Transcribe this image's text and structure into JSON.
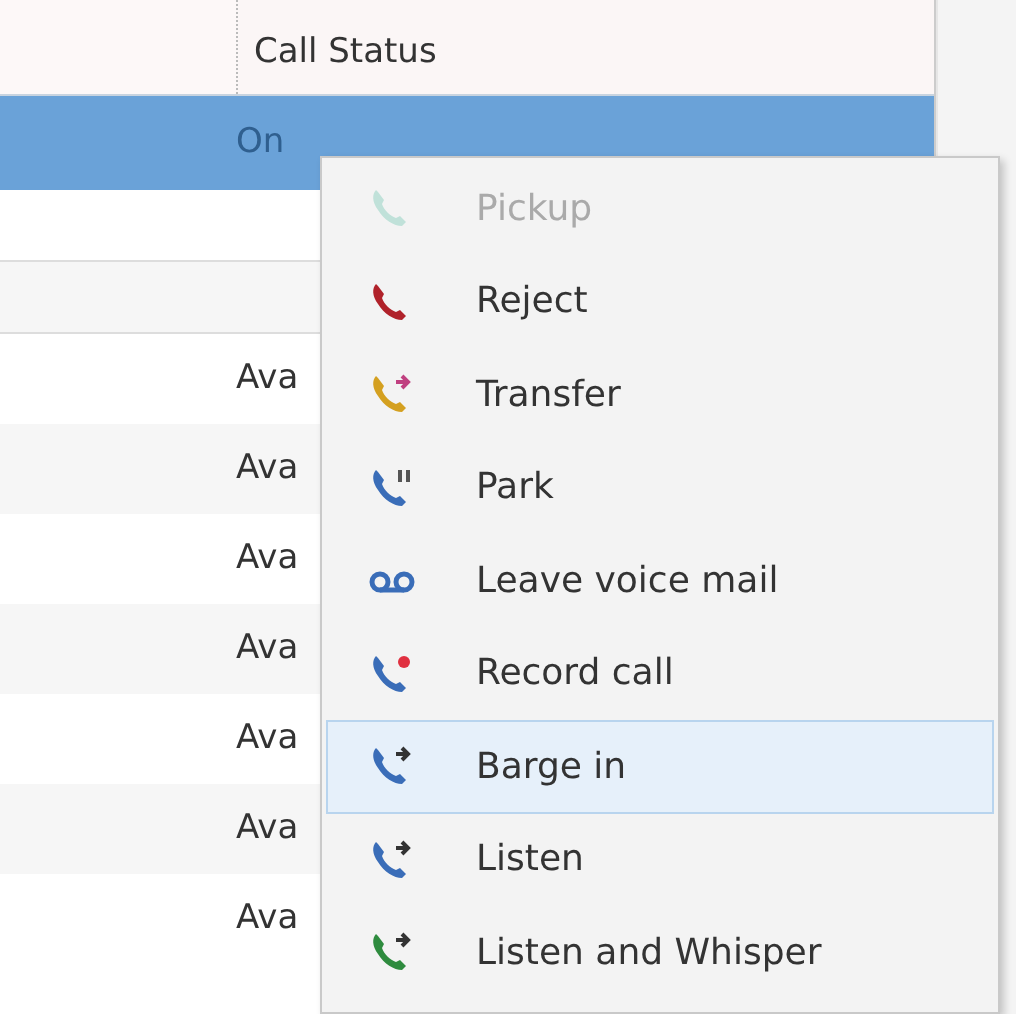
{
  "table": {
    "columns": [
      "Call Status"
    ],
    "rows": [
      {
        "cell": "On",
        "selected": true
      },
      {
        "cell": "",
        "selected": false
      },
      {
        "cell": "",
        "selected": false
      },
      {
        "cell": "Ava",
        "selected": false
      },
      {
        "cell": "Ava",
        "selected": false
      },
      {
        "cell": "Ava",
        "selected": false
      },
      {
        "cell": "Ava",
        "selected": false
      },
      {
        "cell": "Ava",
        "selected": false
      },
      {
        "cell": "Ava",
        "selected": false
      },
      {
        "cell": "Ava",
        "selected": false
      }
    ]
  },
  "context_menu": {
    "items": [
      {
        "label": "Pickup",
        "kind": "pickup",
        "disabled": true,
        "selected": false
      },
      {
        "label": "Reject",
        "kind": "reject",
        "disabled": false,
        "selected": false
      },
      {
        "label": "Transfer",
        "kind": "transfer",
        "disabled": false,
        "selected": false
      },
      {
        "label": "Park",
        "kind": "park",
        "disabled": false,
        "selected": false
      },
      {
        "label": "Leave voice mail",
        "kind": "voicemail",
        "disabled": false,
        "selected": false
      },
      {
        "label": "Record call",
        "kind": "record",
        "disabled": false,
        "selected": false
      },
      {
        "label": "Barge in",
        "kind": "barge",
        "disabled": false,
        "selected": true
      },
      {
        "label": "Listen",
        "kind": "listen",
        "disabled": false,
        "selected": false
      },
      {
        "label": "Listen and Whisper",
        "kind": "whisper",
        "disabled": false,
        "selected": false
      }
    ]
  }
}
